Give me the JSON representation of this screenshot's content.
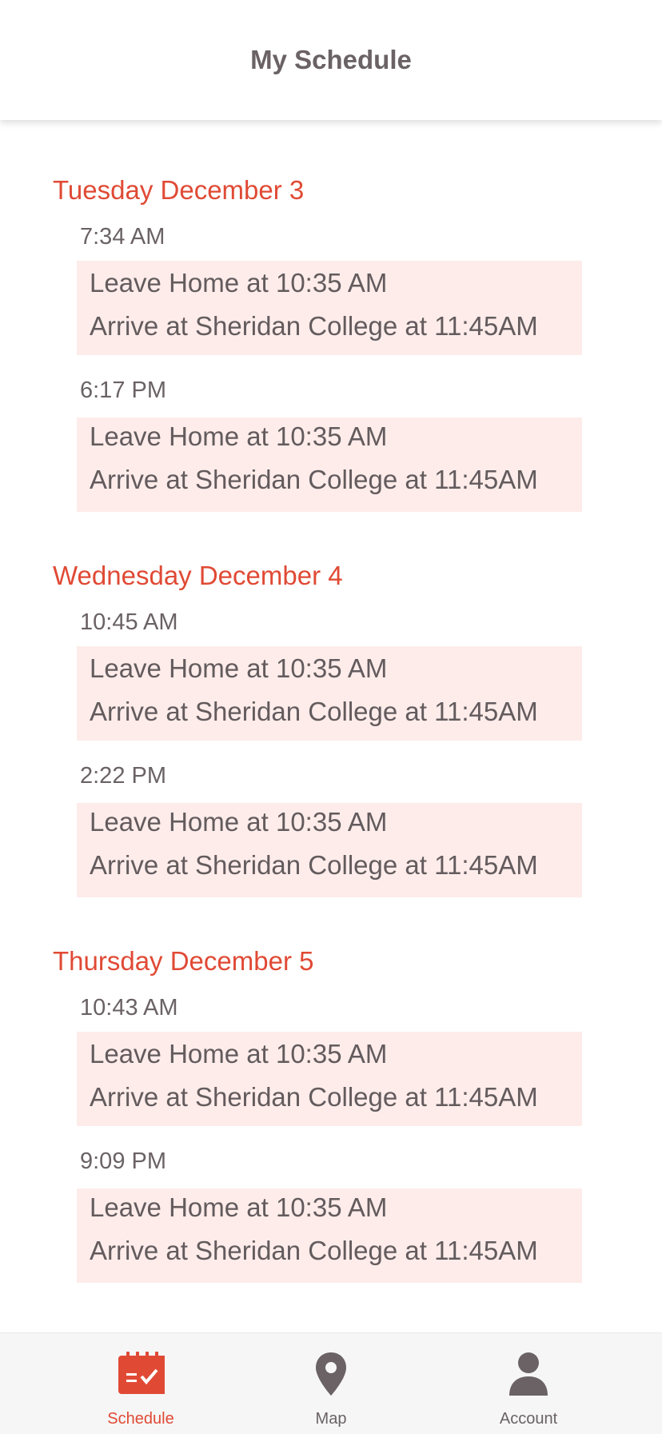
{
  "header": {
    "title": "My Schedule"
  },
  "days": [
    {
      "title": "Tuesday December 3",
      "trips": [
        {
          "time": "7:34 AM",
          "leave": "Leave Home at 10:35 AM",
          "arrive": "Arrive at Sheridan College at 11:45AM"
        },
        {
          "time": "6:17 PM",
          "leave": "Leave Home at 10:35 AM",
          "arrive": "Arrive at Sheridan College at 11:45AM"
        }
      ]
    },
    {
      "title": "Wednesday December 4",
      "trips": [
        {
          "time": "10:45 AM",
          "leave": "Leave Home at 10:35 AM",
          "arrive": "Arrive at Sheridan College at 11:45AM"
        },
        {
          "time": "2:22 PM",
          "leave": "Leave Home at 10:35 AM",
          "arrive": "Arrive at Sheridan College at 11:45AM"
        }
      ]
    },
    {
      "title": "Thursday December 5",
      "trips": [
        {
          "time": "10:43 AM",
          "leave": "Leave Home at 10:35 AM",
          "arrive": "Arrive at Sheridan College at 11:45AM"
        },
        {
          "time": "9:09 PM",
          "leave": "Leave Home at 10:35 AM",
          "arrive": "Arrive at Sheridan College at 11:45AM"
        }
      ]
    }
  ],
  "tabbar": {
    "items": [
      {
        "label": "Schedule",
        "icon": "calendar-check-icon",
        "active": true
      },
      {
        "label": "Map",
        "icon": "map-pin-icon",
        "active": false
      },
      {
        "label": "Account",
        "icon": "person-icon",
        "active": false
      }
    ]
  },
  "colors": {
    "accent": "#e04a35",
    "card": "#fdecea",
    "text": "#635b5d",
    "tabbar": "#f6f6f6"
  }
}
